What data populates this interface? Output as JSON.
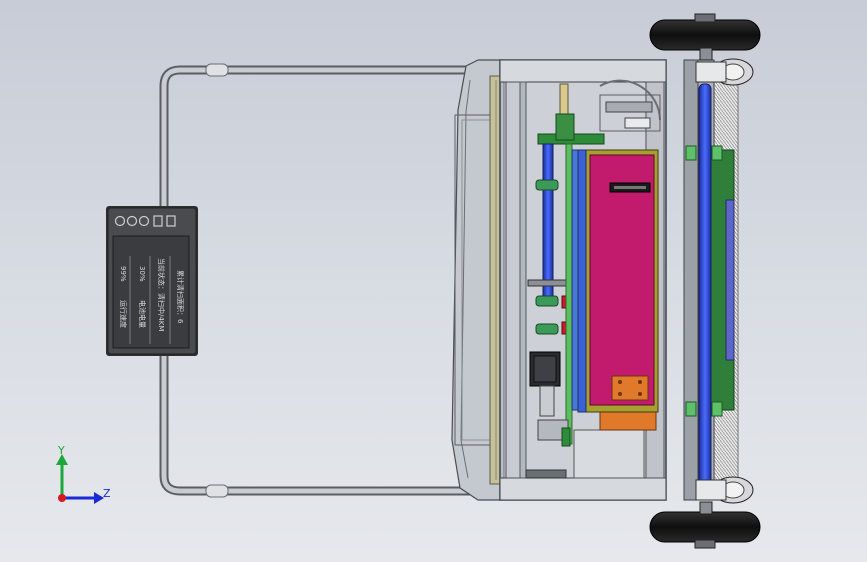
{
  "control_panel": {
    "rows": [
      {
        "label": "运行速度",
        "value": "99%"
      },
      {
        "label": "电池电量",
        "value": "30%"
      },
      {
        "label": "当前状态：清扫中/4KM"
      },
      {
        "label": "累计清扫面积：6"
      }
    ],
    "button_count": 5
  },
  "axis_triad": {
    "y_label": "Y",
    "z_label": "Z",
    "colors": {
      "x": "#d41b1b",
      "y": "#1aa83a",
      "z": "#1a2bd6"
    }
  },
  "colors": {
    "background_top": "#c7ccd6",
    "frame": "#9aa0a8",
    "brush_roller": "#2f4fd1",
    "battery_box": "#c21a6d",
    "mount_plate": "#2e8b3a",
    "panel_body": "#3c3d40",
    "wheel": "#1a1a1a",
    "bearing_plate": "#e07a2a"
  }
}
